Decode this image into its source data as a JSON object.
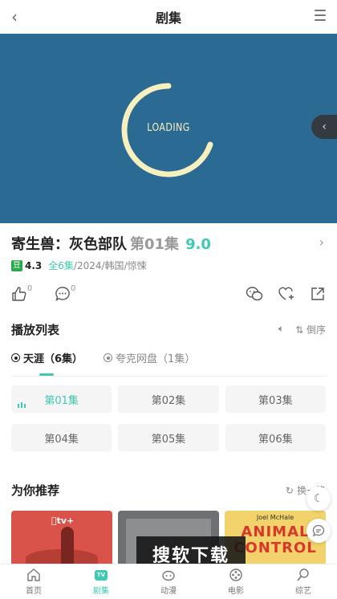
{
  "header": {
    "title": "剧集"
  },
  "player": {
    "loading_text": "LOADING"
  },
  "show": {
    "name": "寄生兽：灰色部队",
    "episode": "第01集",
    "score": "9.0",
    "douban_label": "豆",
    "douban_score": "4.3",
    "total_episodes": "全6集",
    "year": "2024",
    "region": "韩国",
    "genre": "惊悚",
    "sep": " / "
  },
  "actions": {
    "like_count": "0",
    "comment_count": "0"
  },
  "playlist": {
    "title": "播放列表",
    "sort_label": "倒序",
    "sources": [
      {
        "label": "天涯（6集）",
        "active": true
      },
      {
        "label": "夸克网盘（1集）",
        "active": false
      }
    ],
    "episodes": [
      "第01集",
      "第02集",
      "第03集",
      "第04集",
      "第05集",
      "第06集"
    ]
  },
  "recommend": {
    "title": "为你推荐",
    "change_label": "换一换",
    "cards": [
      {
        "badge": "tv+"
      },
      {},
      {
        "actor": "Joel McHale",
        "title_line1": "ANIMAL",
        "title_line2": "CONTROL"
      }
    ]
  },
  "watermark": "搜软下载",
  "tabbar": [
    {
      "label": "首页",
      "icon": "home-icon",
      "active": false
    },
    {
      "label": "剧集",
      "icon": "tv-icon",
      "active": true
    },
    {
      "label": "动漫",
      "icon": "anime-icon",
      "active": false
    },
    {
      "label": "电影",
      "icon": "film-icon",
      "active": false
    },
    {
      "label": "综艺",
      "icon": "variety-icon",
      "active": false
    }
  ],
  "colors": {
    "accent": "#3fc8b3",
    "player_bg": "#2b6a92",
    "loading": "#f6f0bf"
  }
}
